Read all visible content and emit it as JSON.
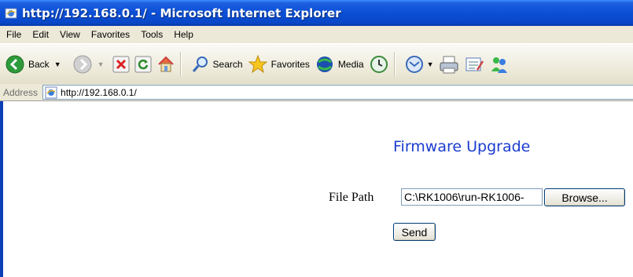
{
  "window": {
    "title": "http://192.168.0.1/ - Microsoft Internet Explorer",
    "title_bar_color": "#0b4fd6"
  },
  "menu": {
    "items": [
      "File",
      "Edit",
      "View",
      "Favorites",
      "Tools",
      "Help"
    ]
  },
  "toolbar": {
    "back_label": "Back",
    "search_label": "Search",
    "favorites_label": "Favorites",
    "media_label": "Media",
    "icons": [
      "back-icon",
      "forward-icon",
      "stop-icon",
      "refresh-icon",
      "home-icon",
      "search-icon",
      "favorites-icon",
      "media-icon",
      "history-icon",
      "mail-icon",
      "print-icon",
      "edit-icon",
      "messenger-icon"
    ]
  },
  "address": {
    "label": "Address",
    "url": "http://192.168.0.1/"
  },
  "page": {
    "heading": "Firmware Upgrade",
    "heading_color": "#1a3ccf",
    "file_path_label": "File Path",
    "file_path_value": "C:\\RK1006\\run-RK1006-",
    "browse_label": "Browse...",
    "send_label": "Send"
  }
}
